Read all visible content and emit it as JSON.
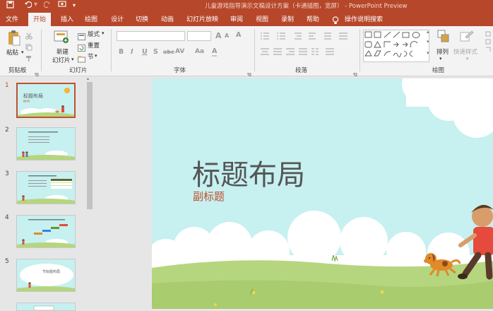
{
  "window": {
    "title": "儿童游戏指导演示文稿设计方案（卡通插图，宽屏） - PowerPoint Preview"
  },
  "qat": {
    "save_icon": "save-icon",
    "undo_icon": "undo-icon",
    "redo_icon": "redo-icon",
    "present_icon": "present-from-start-icon",
    "customize_icon": "customize-qat-icon"
  },
  "tabs": [
    {
      "label": "文件"
    },
    {
      "label": "开始"
    },
    {
      "label": "插入"
    },
    {
      "label": "绘图"
    },
    {
      "label": "设计"
    },
    {
      "label": "切换"
    },
    {
      "label": "动画"
    },
    {
      "label": "幻灯片放映"
    },
    {
      "label": "审阅"
    },
    {
      "label": "视图"
    },
    {
      "label": "录制"
    },
    {
      "label": "帮助"
    },
    {
      "label": "操作说明搜索"
    }
  ],
  "ribbon": {
    "clipboard": {
      "paste_label": "粘贴",
      "group_label": "剪贴板"
    },
    "slides": {
      "new_slide_label_1": "新建",
      "new_slide_label_2": "幻灯片",
      "layout_label": "版式",
      "reset_label": "重置",
      "section_label": "节",
      "group_label": "幻灯片"
    },
    "font": {
      "group_label": "字体",
      "bold": "B",
      "italic": "I",
      "underline": "U",
      "strike": "S",
      "shadow": "abc",
      "spacing": "AV",
      "case": "Aa",
      "color": "A",
      "grow": "A",
      "shrink": "A",
      "clear": "A"
    },
    "paragraph": {
      "group_label": "段落"
    },
    "drawing": {
      "arrange_label": "排列",
      "quick_styles_label": "快速样式",
      "group_label": "绘图"
    }
  },
  "slides": [
    {
      "number": "1",
      "title": "标题布局",
      "subtitle": "副标题"
    },
    {
      "number": "2",
      "title": "",
      "subtitle": ""
    },
    {
      "number": "3",
      "title": "",
      "subtitle": ""
    },
    {
      "number": "4",
      "title": "",
      "subtitle": ""
    },
    {
      "number": "5",
      "title": "节标题布局",
      "subtitle": ""
    }
  ],
  "main_slide": {
    "title": "标题布局",
    "subtitle": "副标题",
    "title_color": "#555555",
    "subtitle_color": "#c0502f"
  },
  "colors": {
    "accent": "#b7472a",
    "selection": "#c0502f",
    "sky": "#c7f0f0",
    "grass": "#b5d67e"
  }
}
